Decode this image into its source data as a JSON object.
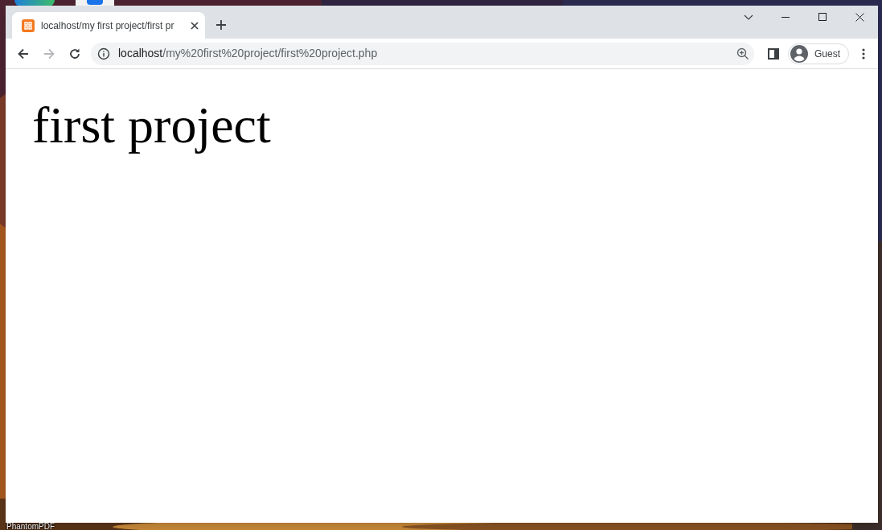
{
  "desktop": {
    "icon_label": "PhantomPDF"
  },
  "tabs": [
    {
      "title": "localhost/my first project/first pr",
      "selected": true
    }
  ],
  "nav_buttons": [
    {
      "kind": "back",
      "disabled": false
    },
    {
      "kind": "forward",
      "disabled": true
    },
    {
      "kind": "reload",
      "disabled": false
    }
  ],
  "address_bar": {
    "host": "localhost",
    "path": "/my%20first%20project/first%20project.php"
  },
  "profile": {
    "label": "Guest"
  },
  "page": {
    "heading": "first project"
  }
}
